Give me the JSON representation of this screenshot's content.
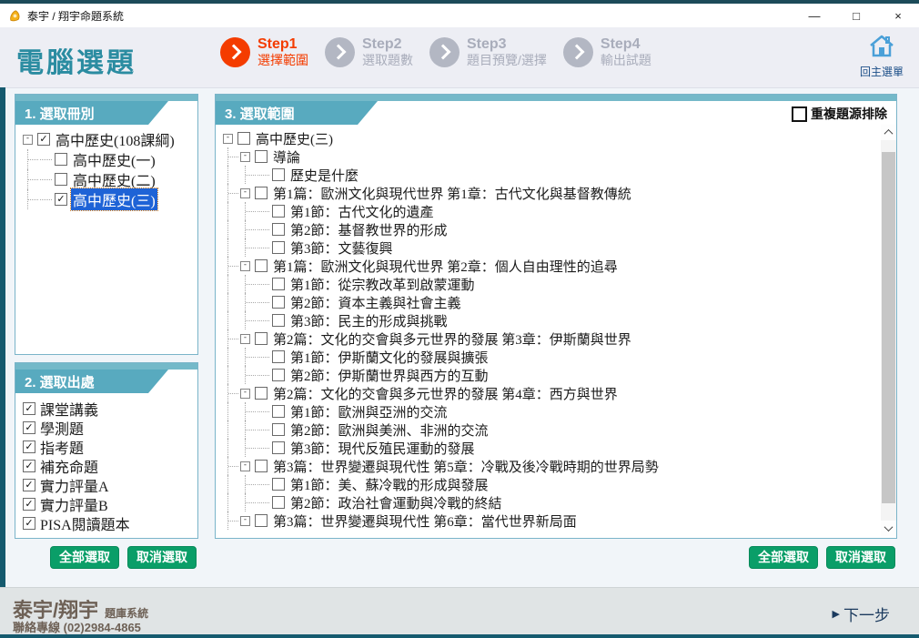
{
  "window": {
    "title": "泰宇 / 翔宇命題系統",
    "minimize": "—",
    "maximize": "□",
    "close": "×"
  },
  "header": {
    "page_title": "電腦選題",
    "active_step": 0,
    "steps": [
      {
        "name": "Step1",
        "label": "選擇範圍"
      },
      {
        "name": "Step2",
        "label": "選取題數"
      },
      {
        "name": "Step3",
        "label": "題目預覽/選擇"
      },
      {
        "name": "Step4",
        "label": "輸出試題"
      }
    ],
    "home_label": "回主選單"
  },
  "panel1": {
    "title": "1. 選取冊別",
    "tree": [
      {
        "t": "高中歷史(108課綱)",
        "l": 0,
        "e": true,
        "c": true,
        "sel": false
      },
      {
        "t": "高中歷史(一)",
        "l": 1,
        "e": false,
        "c": false,
        "sel": false
      },
      {
        "t": "高中歷史(二)",
        "l": 1,
        "e": false,
        "c": false,
        "sel": false
      },
      {
        "t": "高中歷史(三)",
        "l": 1,
        "e": false,
        "c": true,
        "sel": true
      }
    ]
  },
  "panel2": {
    "title": "2. 選取出處",
    "sources": [
      {
        "label": "課堂講義",
        "checked": true
      },
      {
        "label": "學測題",
        "checked": true
      },
      {
        "label": "指考題",
        "checked": true
      },
      {
        "label": "補充命題",
        "checked": true
      },
      {
        "label": "實力評量A",
        "checked": true
      },
      {
        "label": "實力評量B",
        "checked": true
      },
      {
        "label": "PISA閱讀題本",
        "checked": true
      }
    ]
  },
  "panel3": {
    "title": "3. 選取範圍",
    "dedupe_label": "重複題源排除",
    "dedupe_checked": false,
    "tree": [
      {
        "t": "高中歷史(三)",
        "l": 0,
        "e": true,
        "c": false
      },
      {
        "t": "導論",
        "l": 1,
        "e": true,
        "c": false
      },
      {
        "t": "歷史是什麼",
        "l": 2,
        "e": false,
        "c": false
      },
      {
        "t": "第1篇：歐洲文化與現代世界 第1章：古代文化與基督教傳統",
        "l": 1,
        "e": true,
        "c": false
      },
      {
        "t": "第1節：古代文化的遺產",
        "l": 2,
        "e": false,
        "c": false
      },
      {
        "t": "第2節：基督教世界的形成",
        "l": 2,
        "e": false,
        "c": false
      },
      {
        "t": "第3節：文藝復興",
        "l": 2,
        "e": false,
        "c": false
      },
      {
        "t": "第1篇：歐洲文化與現代世界 第2章：個人自由理性的追尋",
        "l": 1,
        "e": true,
        "c": false
      },
      {
        "t": "第1節：從宗教改革到啟蒙運動",
        "l": 2,
        "e": false,
        "c": false
      },
      {
        "t": "第2節：資本主義與社會主義",
        "l": 2,
        "e": false,
        "c": false
      },
      {
        "t": "第3節：民主的形成與挑戰",
        "l": 2,
        "e": false,
        "c": false
      },
      {
        "t": "第2篇：文化的交會與多元世界的發展 第3章：伊斯蘭與世界",
        "l": 1,
        "e": true,
        "c": false
      },
      {
        "t": "第1節：伊斯蘭文化的發展與擴張",
        "l": 2,
        "e": false,
        "c": false
      },
      {
        "t": "第2節：伊斯蘭世界與西方的互動",
        "l": 2,
        "e": false,
        "c": false
      },
      {
        "t": "第2篇：文化的交會與多元世界的發展 第4章：西方與世界",
        "l": 1,
        "e": true,
        "c": false
      },
      {
        "t": "第1節：歐洲與亞洲的交流",
        "l": 2,
        "e": false,
        "c": false
      },
      {
        "t": "第2節：歐洲與美洲、非洲的交流",
        "l": 2,
        "e": false,
        "c": false
      },
      {
        "t": "第3節：現代反殖民運動的發展",
        "l": 2,
        "e": false,
        "c": false
      },
      {
        "t": "第3篇：世界變遷與現代性 第5章：冷戰及後冷戰時期的世界局勢",
        "l": 1,
        "e": true,
        "c": false
      },
      {
        "t": "第1節：美、蘇冷戰的形成與發展",
        "l": 2,
        "e": false,
        "c": false
      },
      {
        "t": "第2節：政治社會運動與冷戰的終結",
        "l": 2,
        "e": false,
        "c": false
      },
      {
        "t": "第3篇：世界變遷與現代性 第6章：當代世界新局面",
        "l": 1,
        "e": true,
        "c": false
      }
    ]
  },
  "buttons": {
    "select_all": "全部選取",
    "deselect_all": "取消選取"
  },
  "footer": {
    "brand": "泰宇/翔宇",
    "brand_suffix": "題庫系統",
    "contact": "聯絡專線 (02)2984-4865",
    "next_icon": "▶",
    "next_label": "下一步"
  },
  "colors": {
    "panel_teal": "#58aabf",
    "panel_strip": "#74b9c9",
    "dark_frame": "#155a6e",
    "step_active": "#f43c00",
    "step_inactive": "#b3b7c3",
    "button_green": "#0a9e68",
    "selected_blue": "#1e63d6",
    "title_teal": "#2b8ca1",
    "footer_text": "#6e6156",
    "next_navy": "#1b3a5e"
  }
}
